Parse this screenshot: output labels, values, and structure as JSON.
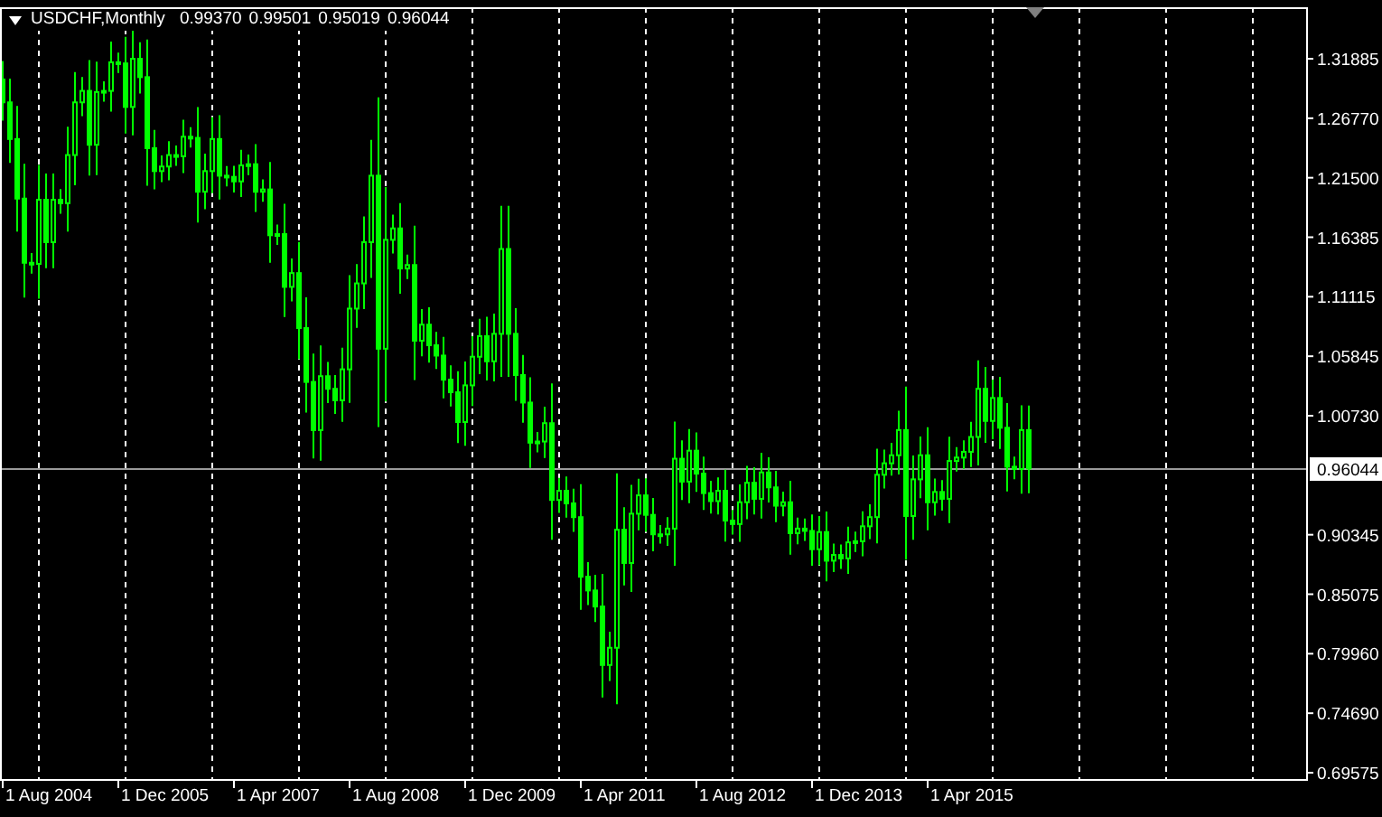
{
  "header": {
    "symbol": "USDCHF,Monthly",
    "quotes": [
      "0.99370",
      "0.99501",
      "0.95019",
      "0.96044"
    ]
  },
  "current_price": "0.96044",
  "price_axis": {
    "labels": [
      "1.31885",
      "1.26770",
      "1.21500",
      "1.16385",
      "1.11115",
      "1.05845",
      "1.00730",
      "0.90345",
      "0.85075",
      "0.79960",
      "0.74690",
      "0.69575"
    ]
  },
  "time_axis": {
    "labels": [
      "1 Aug 2004",
      "1 Dec 2005",
      "1 Apr 2007",
      "1 Aug 2008",
      "1 Dec 2009",
      "1 Apr 2011",
      "1 Aug 2012",
      "1 Dec 2013",
      "1 Apr 2015"
    ]
  }
}
